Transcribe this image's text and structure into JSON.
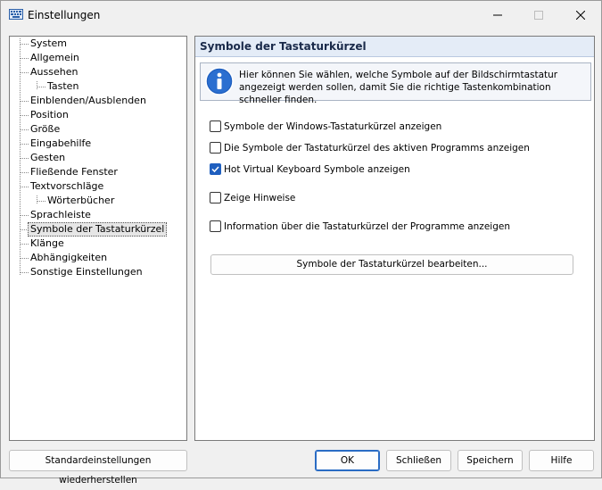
{
  "window": {
    "title": "Einstellungen"
  },
  "tree": {
    "items": [
      {
        "label": "System"
      },
      {
        "label": "Allgemein"
      },
      {
        "label": "Aussehen"
      },
      {
        "label": "Tasten"
      },
      {
        "label": "Einblenden/Ausblenden"
      },
      {
        "label": "Position"
      },
      {
        "label": "Größe"
      },
      {
        "label": "Eingabehilfe"
      },
      {
        "label": "Gesten"
      },
      {
        "label": "Fließende Fenster"
      },
      {
        "label": "Textvorschläge"
      },
      {
        "label": "Wörterbücher"
      },
      {
        "label": "Sprachleiste"
      },
      {
        "label": "Symbole der Tastaturkürzel"
      },
      {
        "label": "Klänge"
      },
      {
        "label": "Abhängigkeiten"
      },
      {
        "label": "Sonstige Einstellungen"
      }
    ],
    "selected": "Symbole der Tastaturkürzel"
  },
  "panel": {
    "title": "Symbole der Tastaturkürzel",
    "info": "Hier können Sie wählen, welche Symbole auf der Bildschirmtastatur angezeigt werden sollen, damit Sie die richtige Tastenkombination schneller finden.",
    "options": [
      {
        "label": "Symbole der Windows-Tastaturkürzel anzeigen",
        "checked": false
      },
      {
        "label": "Die Symbole der Tastaturkürzel des aktiven Programms anzeigen",
        "checked": false
      },
      {
        "label": "Hot Virtual Keyboard Symbole anzeigen",
        "checked": true
      },
      {
        "label": "Zeige Hinweise",
        "checked": false
      },
      {
        "label": "Information über die Tastaturkürzel der Programme anzeigen",
        "checked": false
      }
    ],
    "edit_button": "Symbole der Tastaturkürzel bearbeiten..."
  },
  "footer": {
    "restore_defaults": "Standardeinstellungen wiederherstellen",
    "ok": "OK",
    "close": "Schließen",
    "save": "Speichern",
    "help": "Hilfe"
  },
  "colors": {
    "accent": "#1f5fbf",
    "header_bg": "#e4ecf7"
  }
}
